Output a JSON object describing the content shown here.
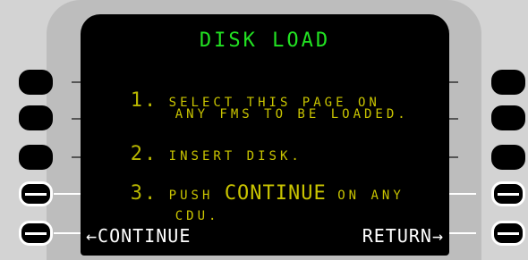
{
  "screen": {
    "title": "DISK LOAD",
    "step1": {
      "num": "1.",
      "line1": "SELECT THIS PAGE ON",
      "line2": "ANY FMS TO BE LOADED."
    },
    "step2": {
      "num": "2.",
      "line1": "INSERT DISK."
    },
    "step3": {
      "num": "3.",
      "prefix": "PUSH",
      "keyword": "CONTINUE",
      "suffix": "ON ANY",
      "line2": "CDU."
    },
    "left_prompt": "←CONTINUE",
    "right_prompt": "RETURN→"
  },
  "colors": {
    "title": "#22e222",
    "text": "#c9c400",
    "prompt": "#ffffff"
  }
}
